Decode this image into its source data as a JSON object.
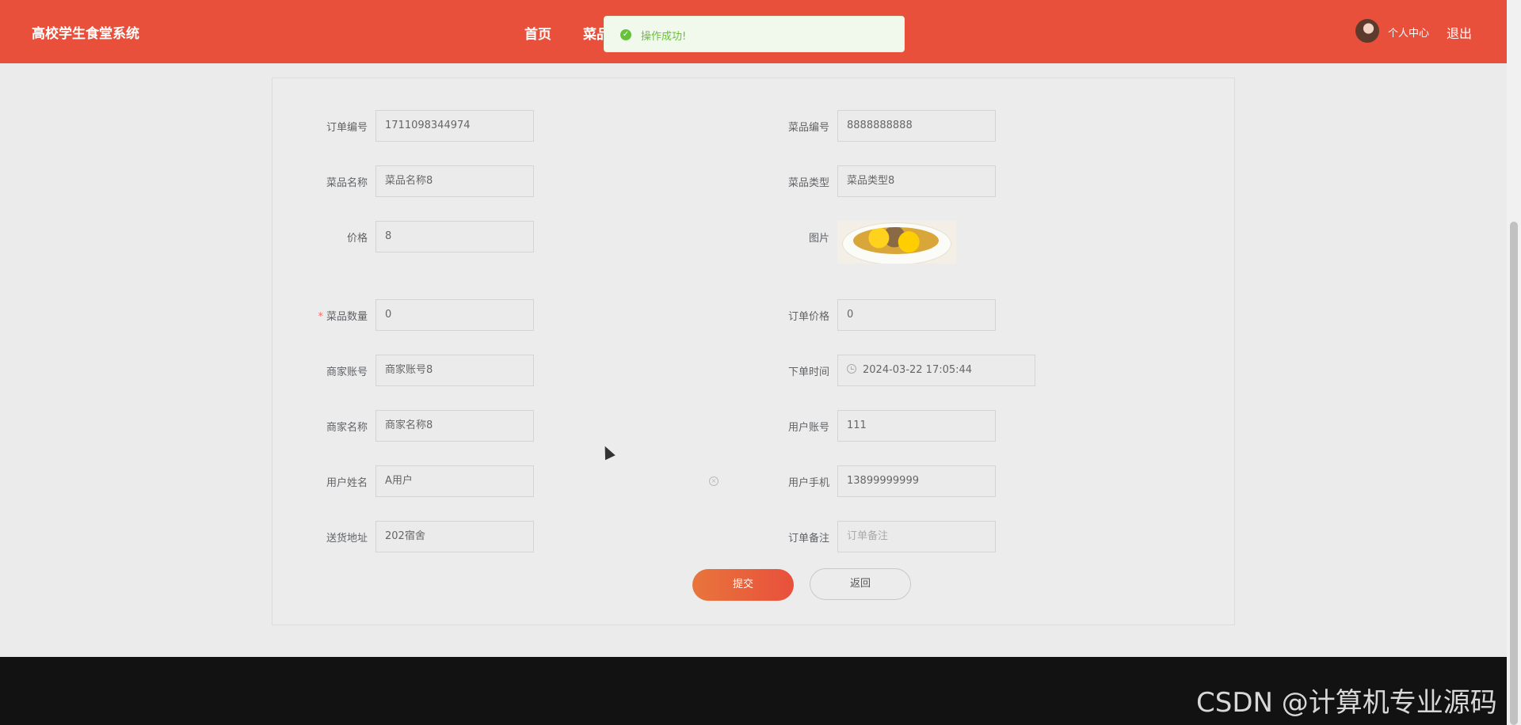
{
  "header": {
    "brand": "高校学生食堂系统",
    "nav": [
      {
        "label": "首页"
      },
      {
        "label": "菜品"
      }
    ],
    "user_center": "个人中心",
    "logout": "退出",
    "bg_color": "#e8503c"
  },
  "toast": {
    "message": "操作成功!",
    "type": "success",
    "icon": "check-circle-icon"
  },
  "form": {
    "order_no": {
      "label": "订单编号",
      "value": "1711098344974"
    },
    "dish_no": {
      "label": "菜品编号",
      "value": "8888888888"
    },
    "dish_name": {
      "label": "菜品名称",
      "value": "菜品名称8"
    },
    "dish_type": {
      "label": "菜品类型",
      "value": "菜品类型8"
    },
    "price": {
      "label": "价格",
      "value": "8"
    },
    "image": {
      "label": "图片"
    },
    "quantity": {
      "label": "菜品数量",
      "required_mark": "*",
      "value": "0"
    },
    "order_price": {
      "label": "订单价格",
      "value": "0"
    },
    "merchant_account": {
      "label": "商家账号",
      "value": "商家账号8"
    },
    "order_time": {
      "label": "下单时间",
      "value": "2024-03-22 17:05:44",
      "icon": "clock-icon"
    },
    "merchant_name": {
      "label": "商家名称",
      "value": "商家名称8"
    },
    "user_account": {
      "label": "用户账号",
      "value": "111"
    },
    "user_name": {
      "label": "用户姓名",
      "value": "A用户"
    },
    "user_phone": {
      "label": "用户手机",
      "value": "13899999999"
    },
    "address": {
      "label": "送货地址",
      "value": "202宿舍"
    },
    "remark": {
      "label": "订单备注",
      "value": "",
      "placeholder": "订单备注"
    },
    "submit": "提交",
    "back": "返回"
  },
  "footer": {
    "watermark": "CSDN @计算机专业源码"
  }
}
